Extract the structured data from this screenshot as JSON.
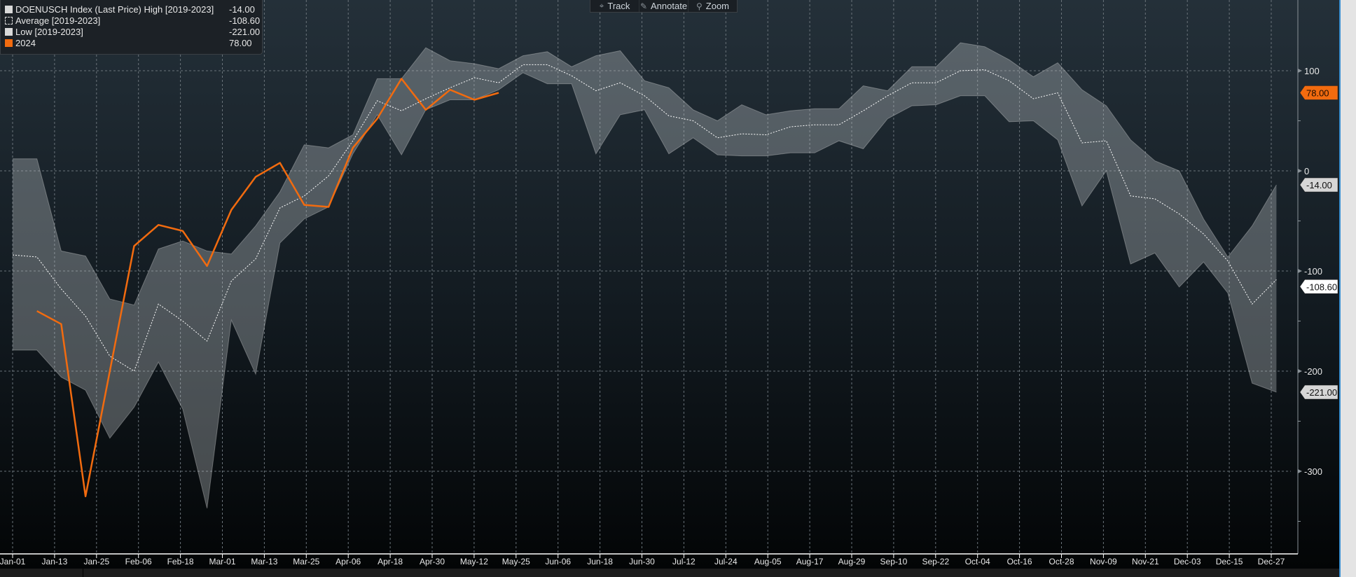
{
  "toolbar": {
    "track": "Track",
    "annotate": "Annotate",
    "zoom": "Zoom"
  },
  "legend": [
    {
      "label": "DOENUSCH Index (Last Price) High [2019-2023]",
      "value": "-14.00",
      "color": "#d9d9d9"
    },
    {
      "label": "Average  [2019-2023]",
      "value": "-108.60",
      "color": "dotted"
    },
    {
      "label": "Low  [2019-2023]",
      "value": "-221.00",
      "color": "#d9d9d9"
    },
    {
      "label": "2024",
      "value": "78.00",
      "color": "#f26b0f"
    }
  ],
  "chart_data": {
    "type": "line",
    "title": "DOENUSCH Index (Last Price)",
    "x_tick_labels": [
      "Jan-01",
      "Jan-13",
      "Jan-25",
      "Feb-06",
      "Feb-18",
      "Mar-01",
      "Mar-13",
      "Mar-25",
      "Apr-06",
      "Apr-18",
      "Apr-30",
      "May-12",
      "May-25",
      "Jun-06",
      "Jun-18",
      "Jun-30",
      "Jul-12",
      "Jul-24",
      "Aug-05",
      "Aug-17",
      "Aug-29",
      "Sep-10",
      "Sep-22",
      "Oct-04",
      "Oct-16",
      "Oct-28",
      "Nov-09",
      "Nov-21",
      "Dec-03",
      "Dec-15",
      "Dec-27"
    ],
    "y_ticks": [
      100,
      0,
      -100,
      -200,
      -300
    ],
    "ylim": [
      -385,
      172
    ],
    "x_unit": "week index (0-52)",
    "grid": true,
    "legend_position": "top-left",
    "series": [
      {
        "name": "High [2019-2023]",
        "color": "#d9d9d9",
        "values": [
          12,
          12,
          -80,
          -85,
          -128,
          -134,
          -78,
          -70,
          -80,
          -83,
          -55,
          -21,
          26,
          23,
          36,
          92,
          92,
          123,
          110,
          107,
          102,
          115,
          119,
          104,
          115,
          120,
          90,
          83,
          61,
          50,
          66,
          56,
          60,
          62,
          62,
          85,
          80,
          104,
          104,
          128,
          124,
          111,
          94,
          108,
          81,
          65,
          31,
          10,
          0,
          -48,
          -86,
          -55,
          -14
        ]
      },
      {
        "name": "Average [2019-2023]",
        "color": "#ffffff",
        "values": [
          -84,
          -86,
          -118,
          -145,
          -185,
          -200,
          -133,
          -150,
          -170,
          -110,
          -88,
          -37,
          -25,
          -5,
          30,
          70,
          60,
          72,
          83,
          93,
          88,
          106,
          106,
          95,
          80,
          88,
          75,
          55,
          50,
          33,
          37,
          36,
          44,
          46,
          46,
          60,
          75,
          88,
          88,
          100,
          101,
          90,
          72,
          78,
          28,
          30,
          -25,
          -28,
          -43,
          -63,
          -90,
          -133,
          -108.6
        ]
      },
      {
        "name": "Low [2019-2023]",
        "color": "#d9d9d9",
        "values": [
          -179,
          -179,
          -206,
          -219,
          -267,
          -236,
          -191,
          -238,
          -337,
          -149,
          -203,
          -72,
          -48,
          -36,
          17,
          56,
          16,
          61,
          71,
          71,
          81,
          98,
          87,
          87,
          17,
          56,
          61,
          17,
          33,
          16,
          15,
          15,
          18,
          18,
          30,
          22,
          52,
          65,
          66,
          75,
          75,
          49,
          50,
          31,
          -35,
          0,
          -93,
          -82,
          -116,
          -91,
          -122,
          -212,
          -221
        ]
      },
      {
        "name": "2024",
        "color": "#f26b0f",
        "start_index": 1,
        "values": [
          -140,
          -153,
          -325,
          -200,
          -75,
          -54,
          -60,
          -95,
          -39,
          -6,
          8,
          -34,
          -36,
          23,
          52,
          92,
          61,
          81,
          71,
          78
        ]
      }
    ],
    "last_value_tags": [
      {
        "series": "2024",
        "value": 78.0,
        "label": "78.00"
      },
      {
        "series": "High",
        "value": -14.0,
        "label": "-14.00"
      },
      {
        "series": "Average",
        "value": -108.6,
        "label": "-108.60"
      },
      {
        "series": "Low",
        "value": -221.0,
        "label": "-221.00"
      }
    ]
  }
}
